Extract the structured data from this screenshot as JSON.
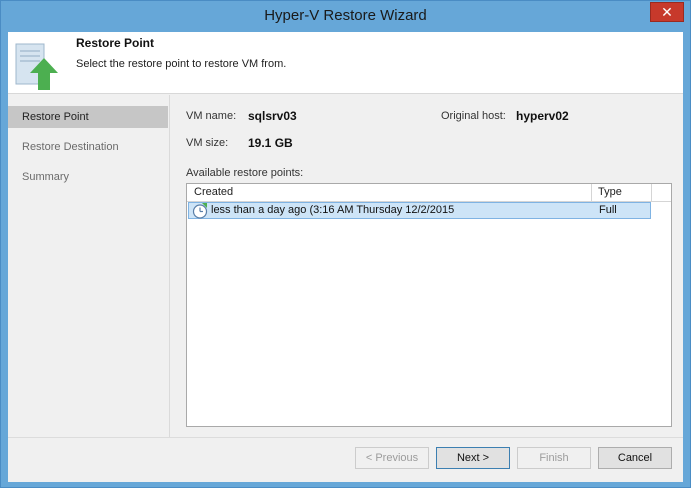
{
  "window": {
    "title": "Hyper-V Restore Wizard",
    "close_glyph": "✕"
  },
  "header": {
    "title": "Restore Point",
    "description": "Select the restore point to restore VM from.",
    "icon": "restore-server-icon"
  },
  "sidebar": {
    "steps": [
      {
        "label": "Restore Point",
        "active": true
      },
      {
        "label": "Restore Destination",
        "active": false
      },
      {
        "label": "Summary",
        "active": false
      }
    ]
  },
  "vm": {
    "name_label": "VM name:",
    "name": "sqlsrv03",
    "host_label": "Original host:",
    "host": "hyperv02",
    "size_label": "VM size:",
    "size": "19.1 GB"
  },
  "restore_points": {
    "label": "Available restore points:",
    "columns": {
      "created": "Created",
      "type": "Type"
    },
    "rows": [
      {
        "created": "less than a day ago (3:16 AM Thursday 12/2/2015",
        "type": "Full",
        "selected": true
      }
    ]
  },
  "buttons": {
    "previous": "< Previous",
    "next": "Next >",
    "finish": "Finish",
    "cancel": "Cancel"
  },
  "colors": {
    "accent": "#66a7d8",
    "selection": "#cde4f7",
    "close": "#c7392b",
    "arrow": "#4caf50"
  }
}
